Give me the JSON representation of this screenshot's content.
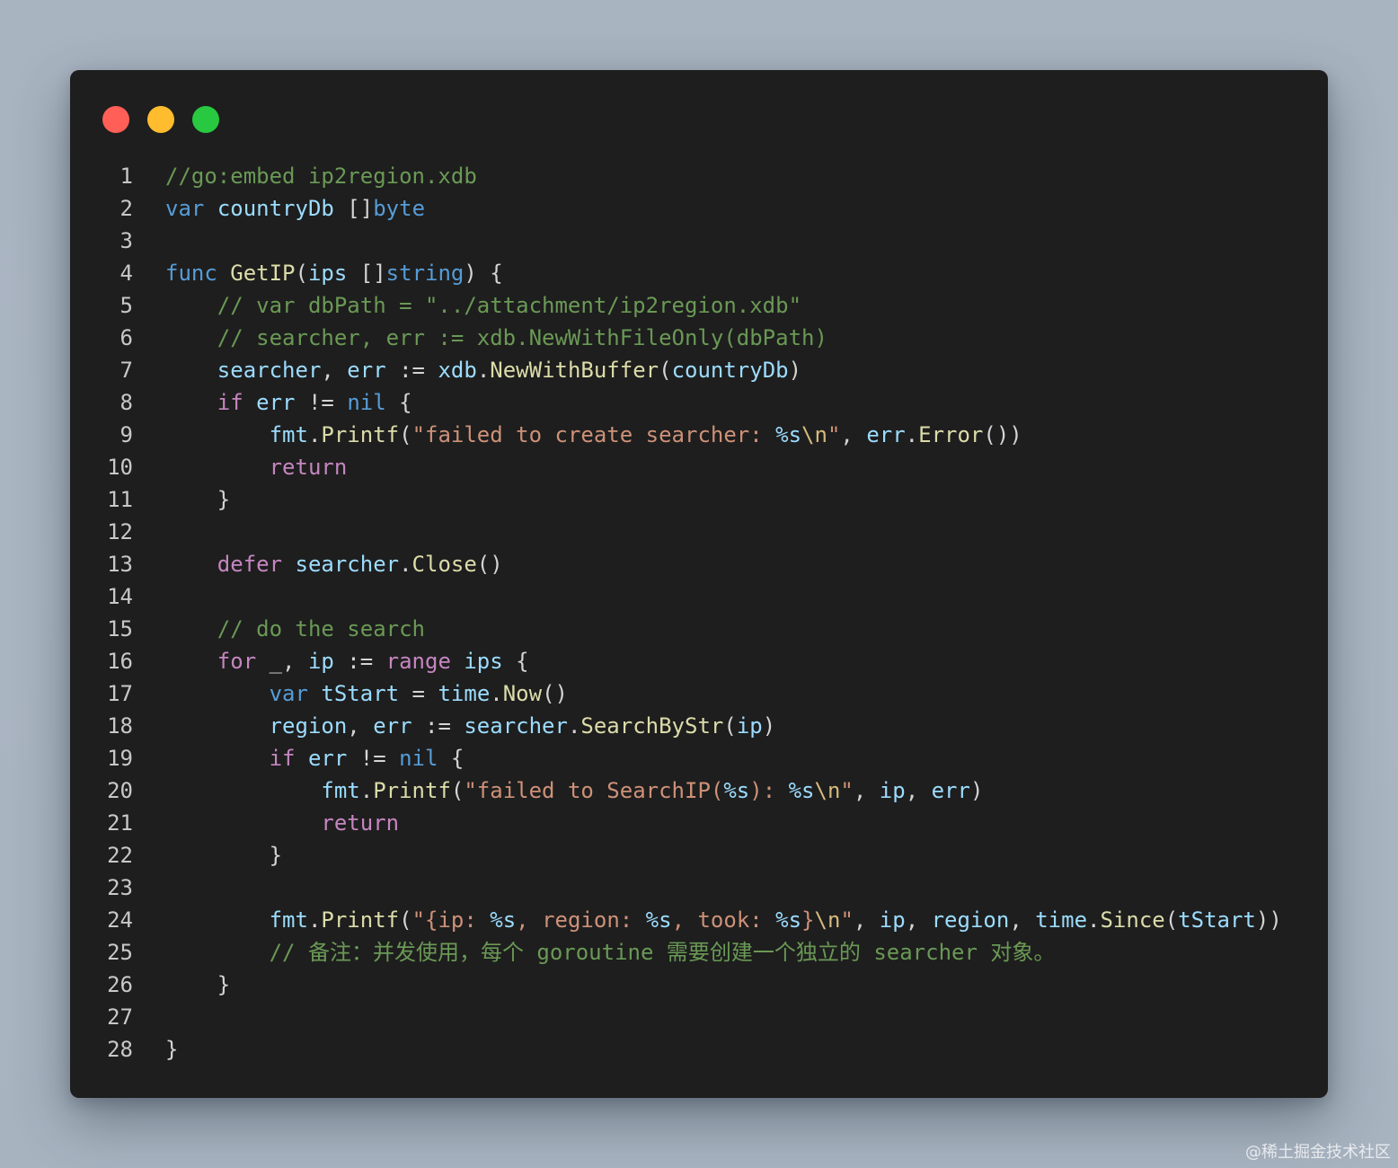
{
  "window": {
    "controls": [
      {
        "name": "close-button",
        "color": "#ff5f57"
      },
      {
        "name": "minimize-button",
        "color": "#febc2e"
      },
      {
        "name": "maximize-button",
        "color": "#28c840"
      }
    ]
  },
  "colors": {
    "plain": "#d4d4d4",
    "keyword": "#569cd6",
    "control": "#c586c0",
    "variable": "#9cdcfe",
    "function": "#dcdcaa",
    "type": "#4ec9b0",
    "string": "#ce9178",
    "escape": "#d7ba7d",
    "comment": "#6a9955"
  },
  "code": {
    "lines": [
      {
        "n": "1",
        "tokens": [
          {
            "t": "//go:embed ip2region.xdb",
            "c": "comment"
          }
        ]
      },
      {
        "n": "2",
        "tokens": [
          {
            "t": "var",
            "c": "keyword"
          },
          {
            "t": " ",
            "c": "plain"
          },
          {
            "t": "countryDb",
            "c": "variable"
          },
          {
            "t": " []",
            "c": "plain"
          },
          {
            "t": "byte",
            "c": "keyword"
          }
        ]
      },
      {
        "n": "3",
        "tokens": []
      },
      {
        "n": "4",
        "tokens": [
          {
            "t": "func",
            "c": "keyword"
          },
          {
            "t": " ",
            "c": "plain"
          },
          {
            "t": "GetIP",
            "c": "function"
          },
          {
            "t": "(",
            "c": "plain"
          },
          {
            "t": "ips",
            "c": "variable"
          },
          {
            "t": " []",
            "c": "plain"
          },
          {
            "t": "string",
            "c": "keyword"
          },
          {
            "t": ") {",
            "c": "plain"
          }
        ]
      },
      {
        "n": "5",
        "tokens": [
          {
            "t": "    // var dbPath = \"../attachment/ip2region.xdb\"",
            "c": "comment"
          }
        ]
      },
      {
        "n": "6",
        "tokens": [
          {
            "t": "    // searcher, err := xdb.NewWithFileOnly(dbPath)",
            "c": "comment"
          }
        ]
      },
      {
        "n": "7",
        "tokens": [
          {
            "t": "    ",
            "c": "plain"
          },
          {
            "t": "searcher",
            "c": "variable"
          },
          {
            "t": ", ",
            "c": "plain"
          },
          {
            "t": "err",
            "c": "variable"
          },
          {
            "t": " := ",
            "c": "plain"
          },
          {
            "t": "xdb",
            "c": "variable"
          },
          {
            "t": ".",
            "c": "plain"
          },
          {
            "t": "NewWithBuffer",
            "c": "function"
          },
          {
            "t": "(",
            "c": "plain"
          },
          {
            "t": "countryDb",
            "c": "variable"
          },
          {
            "t": ")",
            "c": "plain"
          }
        ]
      },
      {
        "n": "8",
        "tokens": [
          {
            "t": "    ",
            "c": "plain"
          },
          {
            "t": "if",
            "c": "control"
          },
          {
            "t": " ",
            "c": "plain"
          },
          {
            "t": "err",
            "c": "variable"
          },
          {
            "t": " != ",
            "c": "plain"
          },
          {
            "t": "nil",
            "c": "keyword"
          },
          {
            "t": " {",
            "c": "plain"
          }
        ]
      },
      {
        "n": "9",
        "tokens": [
          {
            "t": "        ",
            "c": "plain"
          },
          {
            "t": "fmt",
            "c": "variable"
          },
          {
            "t": ".",
            "c": "plain"
          },
          {
            "t": "Printf",
            "c": "function"
          },
          {
            "t": "(",
            "c": "plain"
          },
          {
            "t": "\"failed to create searcher: ",
            "c": "string"
          },
          {
            "t": "%s",
            "c": "variable"
          },
          {
            "t": "\\n",
            "c": "escape"
          },
          {
            "t": "\"",
            "c": "string"
          },
          {
            "t": ", ",
            "c": "plain"
          },
          {
            "t": "err",
            "c": "variable"
          },
          {
            "t": ".",
            "c": "plain"
          },
          {
            "t": "Error",
            "c": "function"
          },
          {
            "t": "())",
            "c": "plain"
          }
        ]
      },
      {
        "n": "10",
        "tokens": [
          {
            "t": "        ",
            "c": "plain"
          },
          {
            "t": "return",
            "c": "control"
          }
        ]
      },
      {
        "n": "11",
        "tokens": [
          {
            "t": "    }",
            "c": "plain"
          }
        ]
      },
      {
        "n": "12",
        "tokens": []
      },
      {
        "n": "13",
        "tokens": [
          {
            "t": "    ",
            "c": "plain"
          },
          {
            "t": "defer",
            "c": "control"
          },
          {
            "t": " ",
            "c": "plain"
          },
          {
            "t": "searcher",
            "c": "variable"
          },
          {
            "t": ".",
            "c": "plain"
          },
          {
            "t": "Close",
            "c": "function"
          },
          {
            "t": "()",
            "c": "plain"
          }
        ]
      },
      {
        "n": "14",
        "tokens": []
      },
      {
        "n": "15",
        "tokens": [
          {
            "t": "    // do the search",
            "c": "comment"
          }
        ]
      },
      {
        "n": "16",
        "tokens": [
          {
            "t": "    ",
            "c": "plain"
          },
          {
            "t": "for",
            "c": "control"
          },
          {
            "t": " _, ",
            "c": "plain"
          },
          {
            "t": "ip",
            "c": "variable"
          },
          {
            "t": " := ",
            "c": "plain"
          },
          {
            "t": "range",
            "c": "control"
          },
          {
            "t": " ",
            "c": "plain"
          },
          {
            "t": "ips",
            "c": "variable"
          },
          {
            "t": " {",
            "c": "plain"
          }
        ]
      },
      {
        "n": "17",
        "tokens": [
          {
            "t": "        ",
            "c": "plain"
          },
          {
            "t": "var",
            "c": "keyword"
          },
          {
            "t": " ",
            "c": "plain"
          },
          {
            "t": "tStart",
            "c": "variable"
          },
          {
            "t": " = ",
            "c": "plain"
          },
          {
            "t": "time",
            "c": "variable"
          },
          {
            "t": ".",
            "c": "plain"
          },
          {
            "t": "Now",
            "c": "function"
          },
          {
            "t": "()",
            "c": "plain"
          }
        ]
      },
      {
        "n": "18",
        "tokens": [
          {
            "t": "        ",
            "c": "plain"
          },
          {
            "t": "region",
            "c": "variable"
          },
          {
            "t": ", ",
            "c": "plain"
          },
          {
            "t": "err",
            "c": "variable"
          },
          {
            "t": " := ",
            "c": "plain"
          },
          {
            "t": "searcher",
            "c": "variable"
          },
          {
            "t": ".",
            "c": "plain"
          },
          {
            "t": "SearchByStr",
            "c": "function"
          },
          {
            "t": "(",
            "c": "plain"
          },
          {
            "t": "ip",
            "c": "variable"
          },
          {
            "t": ")",
            "c": "plain"
          }
        ]
      },
      {
        "n": "19",
        "tokens": [
          {
            "t": "        ",
            "c": "plain"
          },
          {
            "t": "if",
            "c": "control"
          },
          {
            "t": " ",
            "c": "plain"
          },
          {
            "t": "err",
            "c": "variable"
          },
          {
            "t": " != ",
            "c": "plain"
          },
          {
            "t": "nil",
            "c": "keyword"
          },
          {
            "t": " {",
            "c": "plain"
          }
        ]
      },
      {
        "n": "20",
        "tokens": [
          {
            "t": "            ",
            "c": "plain"
          },
          {
            "t": "fmt",
            "c": "variable"
          },
          {
            "t": ".",
            "c": "plain"
          },
          {
            "t": "Printf",
            "c": "function"
          },
          {
            "t": "(",
            "c": "plain"
          },
          {
            "t": "\"failed to SearchIP(",
            "c": "string"
          },
          {
            "t": "%s",
            "c": "variable"
          },
          {
            "t": "): ",
            "c": "string"
          },
          {
            "t": "%s",
            "c": "variable"
          },
          {
            "t": "\\n",
            "c": "escape"
          },
          {
            "t": "\"",
            "c": "string"
          },
          {
            "t": ", ",
            "c": "plain"
          },
          {
            "t": "ip",
            "c": "variable"
          },
          {
            "t": ", ",
            "c": "plain"
          },
          {
            "t": "err",
            "c": "variable"
          },
          {
            "t": ")",
            "c": "plain"
          }
        ]
      },
      {
        "n": "21",
        "tokens": [
          {
            "t": "            ",
            "c": "plain"
          },
          {
            "t": "return",
            "c": "control"
          }
        ]
      },
      {
        "n": "22",
        "tokens": [
          {
            "t": "        }",
            "c": "plain"
          }
        ]
      },
      {
        "n": "23",
        "tokens": []
      },
      {
        "n": "24",
        "tokens": [
          {
            "t": "        ",
            "c": "plain"
          },
          {
            "t": "fmt",
            "c": "variable"
          },
          {
            "t": ".",
            "c": "plain"
          },
          {
            "t": "Printf",
            "c": "function"
          },
          {
            "t": "(",
            "c": "plain"
          },
          {
            "t": "\"{ip: ",
            "c": "string"
          },
          {
            "t": "%s",
            "c": "variable"
          },
          {
            "t": ", region: ",
            "c": "string"
          },
          {
            "t": "%s",
            "c": "variable"
          },
          {
            "t": ", took: ",
            "c": "string"
          },
          {
            "t": "%s",
            "c": "variable"
          },
          {
            "t": "}",
            "c": "string"
          },
          {
            "t": "\\n",
            "c": "escape"
          },
          {
            "t": "\"",
            "c": "string"
          },
          {
            "t": ", ",
            "c": "plain"
          },
          {
            "t": "ip",
            "c": "variable"
          },
          {
            "t": ", ",
            "c": "plain"
          },
          {
            "t": "region",
            "c": "variable"
          },
          {
            "t": ", ",
            "c": "plain"
          },
          {
            "t": "time",
            "c": "variable"
          },
          {
            "t": ".",
            "c": "plain"
          },
          {
            "t": "Since",
            "c": "function"
          },
          {
            "t": "(",
            "c": "plain"
          },
          {
            "t": "tStart",
            "c": "variable"
          },
          {
            "t": "))",
            "c": "plain"
          }
        ]
      },
      {
        "n": "25",
        "tokens": [
          {
            "t": "        // 备注：并发使用，每个 goroutine 需要创建一个独立的 searcher 对象。",
            "c": "comment"
          }
        ]
      },
      {
        "n": "26",
        "tokens": [
          {
            "t": "    }",
            "c": "plain"
          }
        ]
      },
      {
        "n": "27",
        "tokens": []
      },
      {
        "n": "28",
        "tokens": [
          {
            "t": "}",
            "c": "plain"
          }
        ]
      }
    ]
  },
  "watermark": "@稀土掘金技术社区"
}
